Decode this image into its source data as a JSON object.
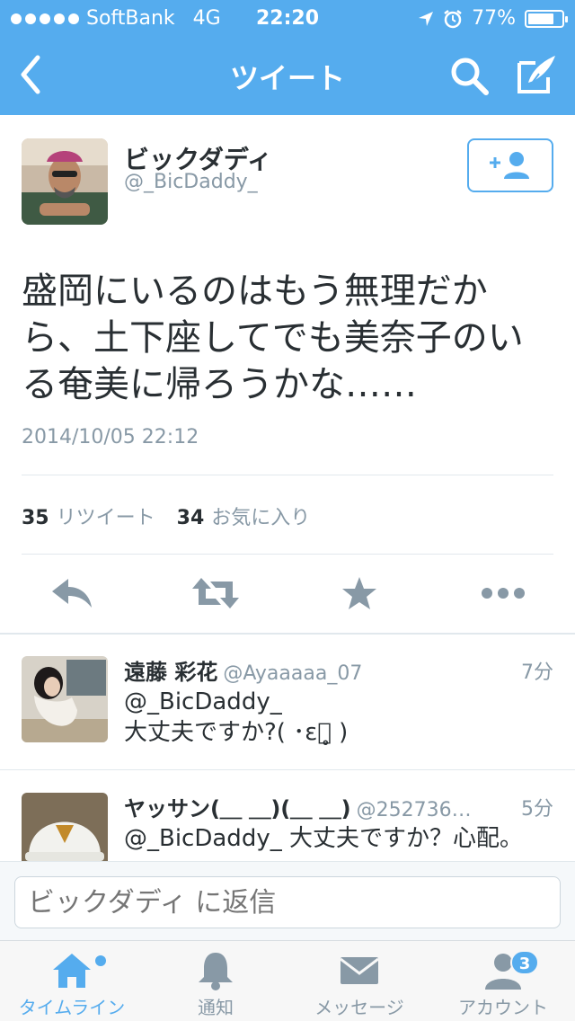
{
  "status_bar": {
    "carrier": "SoftBank",
    "network": "4G",
    "time": "22:20",
    "battery": "77%",
    "battery_level": 0.77
  },
  "nav": {
    "title": "ツイート"
  },
  "tweet": {
    "author_name": "ビックダディ",
    "author_handle": "@_BicDaddy_",
    "text": "盛岡にいるのはもう無理だから、土下座してでも美奈子のいる奄美に帰ろうかな……",
    "timestamp": "2014/10/05 22:12",
    "retweet_count": "35",
    "retweet_label": "リツイート",
    "favorite_count": "34",
    "favorite_label": "お気に入り"
  },
  "replies": [
    {
      "name": "遠藤 彩花",
      "handle": "@Ayaaaaa_07",
      "time": "7分",
      "text": "@_BicDaddy_\n大丈夫ですか?( ･ε･̥ )"
    },
    {
      "name": "ヤッサン(＿ ＿)(＿ ＿)",
      "handle": "@252736…",
      "time": "5分",
      "text": "@_BicDaddy_ 大丈夫ですか？心配。"
    }
  ],
  "composer": {
    "placeholder": "ビックダディ に返信"
  },
  "tabs": [
    {
      "label": "タイムライン",
      "icon": "home-icon",
      "active": true
    },
    {
      "label": "通知",
      "icon": "bell-icon"
    },
    {
      "label": "メッセージ",
      "icon": "envelope-icon"
    },
    {
      "label": "アカウント",
      "icon": "person-icon",
      "badge": "3"
    }
  ],
  "colors": {
    "brand": "#55acee",
    "text": "#292f33",
    "muted": "#8899a6",
    "border": "#e1e8ed"
  }
}
